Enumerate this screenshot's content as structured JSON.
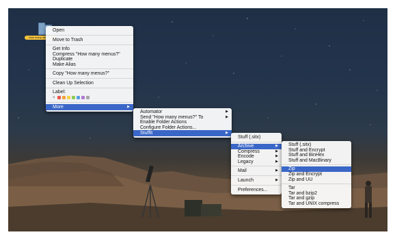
{
  "desktop": {
    "folder_label": "How many menus?"
  },
  "context_menu": {
    "open": "Open",
    "move_to_trash": "Move to Trash",
    "get_info": "Get Info",
    "compress": "Compress \"How many menus?\"",
    "duplicate": "Duplicate",
    "make_alias": "Make Alias",
    "copy": "Copy \"How many menus?\"",
    "clean_up": "Clean Up Selection",
    "label_heading": "Label:",
    "label_clear": "×",
    "label_colors": [
      "#e8584f",
      "#f2a33a",
      "#f4d34a",
      "#8fcb55",
      "#5b9de1",
      "#b07bd3",
      "#a7a7a7"
    ],
    "more": "More"
  },
  "more_menu": {
    "automator": "Automator",
    "send_to": "Send \"How many menus?\" To",
    "enable_folder_actions": "Enable Folder Actions",
    "configure_folder_actions": "Configure Folder Actions...",
    "stuffit": "StuffIt"
  },
  "stuffit_menu": {
    "stuff_sitx": "Stuff (.sitx)",
    "archive": "Archive",
    "compress": "Compress",
    "encode": "Encode",
    "legacy": "Legacy",
    "mail": "Mail",
    "launch": "Launch",
    "preferences": "Preferences..."
  },
  "archive_menu": {
    "group1": [
      "Stuff (.sitx)",
      "Stuff and Encrypt",
      "Stuff and BinHex",
      "Stuff and MacBinary"
    ],
    "zip": "Zip",
    "group2": [
      "Zip and Encrypt",
      "Zip and UU"
    ],
    "group3": [
      "Tar",
      "Tar and bzip2",
      "Tar and gzip",
      "Tar and UNIX compress"
    ]
  },
  "colors": {
    "selection": "#3a67c7",
    "menu_bg": "#fafafa",
    "sky_top": "#1f2f46",
    "ground": "#5b4a39"
  }
}
